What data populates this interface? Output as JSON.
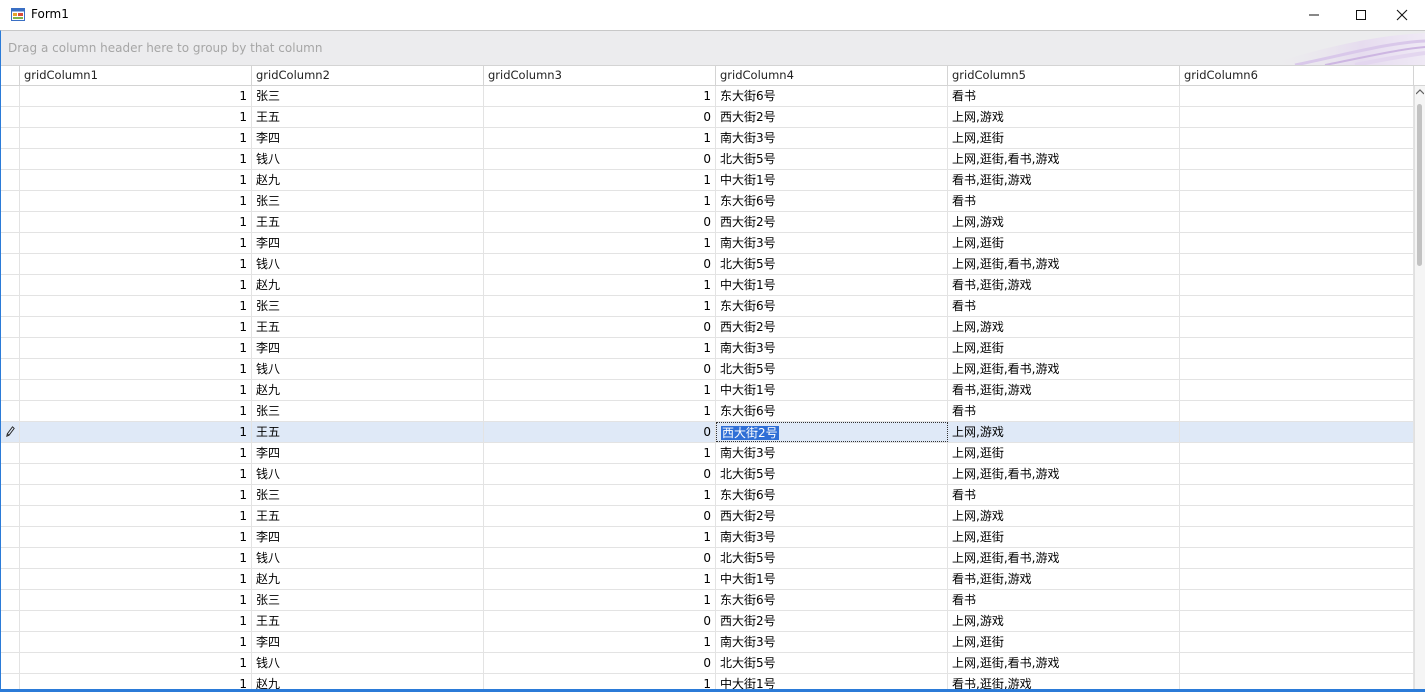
{
  "window": {
    "title": "Form1"
  },
  "group_panel": {
    "hint": "Drag a column header here to group by that column"
  },
  "columns": [
    {
      "label": "gridColumn1"
    },
    {
      "label": "gridColumn2"
    },
    {
      "label": "gridColumn3"
    },
    {
      "label": "gridColumn4"
    },
    {
      "label": "gridColumn5"
    },
    {
      "label": "gridColumn6"
    }
  ],
  "rows": [
    [
      "1",
      "张三",
      "1",
      "东大街6号",
      "看书",
      ""
    ],
    [
      "1",
      "王五",
      "0",
      "西大街2号",
      "上网,游戏",
      ""
    ],
    [
      "1",
      "李四",
      "1",
      "南大街3号",
      "上网,逛街",
      ""
    ],
    [
      "1",
      "钱八",
      "0",
      "北大街5号",
      "上网,逛街,看书,游戏",
      ""
    ],
    [
      "1",
      "赵九",
      "1",
      "中大街1号",
      "看书,逛街,游戏",
      ""
    ],
    [
      "1",
      "张三",
      "1",
      "东大街6号",
      "看书",
      ""
    ],
    [
      "1",
      "王五",
      "0",
      "西大街2号",
      "上网,游戏",
      ""
    ],
    [
      "1",
      "李四",
      "1",
      "南大街3号",
      "上网,逛街",
      ""
    ],
    [
      "1",
      "钱八",
      "0",
      "北大街5号",
      "上网,逛街,看书,游戏",
      ""
    ],
    [
      "1",
      "赵九",
      "1",
      "中大街1号",
      "看书,逛街,游戏",
      ""
    ],
    [
      "1",
      "张三",
      "1",
      "东大街6号",
      "看书",
      ""
    ],
    [
      "1",
      "王五",
      "0",
      "西大街2号",
      "上网,游戏",
      ""
    ],
    [
      "1",
      "李四",
      "1",
      "南大街3号",
      "上网,逛街",
      ""
    ],
    [
      "1",
      "钱八",
      "0",
      "北大街5号",
      "上网,逛街,看书,游戏",
      ""
    ],
    [
      "1",
      "赵九",
      "1",
      "中大街1号",
      "看书,逛街,游戏",
      ""
    ],
    [
      "1",
      "张三",
      "1",
      "东大街6号",
      "看书",
      ""
    ],
    [
      "1",
      "王五",
      "0",
      "西大街2号",
      "上网,游戏",
      ""
    ],
    [
      "1",
      "李四",
      "1",
      "南大街3号",
      "上网,逛街",
      ""
    ],
    [
      "1",
      "钱八",
      "0",
      "北大街5号",
      "上网,逛街,看书,游戏",
      ""
    ],
    [
      "1",
      "张三",
      "1",
      "东大街6号",
      "看书",
      ""
    ],
    [
      "1",
      "王五",
      "0",
      "西大街2号",
      "上网,游戏",
      ""
    ],
    [
      "1",
      "李四",
      "1",
      "南大街3号",
      "上网,逛街",
      ""
    ],
    [
      "1",
      "钱八",
      "0",
      "北大街5号",
      "上网,逛街,看书,游戏",
      ""
    ],
    [
      "1",
      "赵九",
      "1",
      "中大街1号",
      "看书,逛街,游戏",
      ""
    ],
    [
      "1",
      "张三",
      "1",
      "东大街6号",
      "看书",
      ""
    ],
    [
      "1",
      "王五",
      "0",
      "西大街2号",
      "上网,游戏",
      ""
    ],
    [
      "1",
      "李四",
      "1",
      "南大街3号",
      "上网,逛街",
      ""
    ],
    [
      "1",
      "钱八",
      "0",
      "北大街5号",
      "上网,逛街,看书,游戏",
      ""
    ],
    [
      "1",
      "赵九",
      "1",
      "中大街1号",
      "看书,逛街,游戏",
      ""
    ]
  ],
  "focused_row": 16,
  "editing_column": 3,
  "icons": {
    "app": "form-app-icon",
    "minimize": "minimize-icon",
    "maximize": "maximize-icon",
    "close": "close-icon",
    "row_indicator": "pencil-edit-icon"
  },
  "colors": {
    "focused_row": "#dfe9f7",
    "selection": "#2f6fd6",
    "accent": "#2b7bd8"
  }
}
